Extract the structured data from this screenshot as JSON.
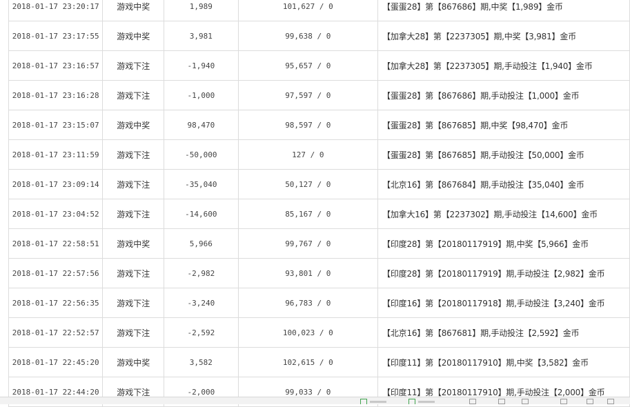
{
  "transactions": [
    {
      "time": "2018-01-17 23:20:17",
      "type": "游戏中奖",
      "amount": "1,989",
      "balance": "101,627 / 0",
      "desc": "【蛋蛋28】第【867686】期,中奖【1,989】金币"
    },
    {
      "time": "2018-01-17 23:17:55",
      "type": "游戏中奖",
      "amount": "3,981",
      "balance": "99,638 / 0",
      "desc": "【加拿大28】第【2237305】期,中奖【3,981】金币"
    },
    {
      "time": "2018-01-17 23:16:57",
      "type": "游戏下注",
      "amount": "-1,940",
      "balance": "95,657 / 0",
      "desc": "【加拿大28】第【2237305】期,手动投注【1,940】金币"
    },
    {
      "time": "2018-01-17 23:16:28",
      "type": "游戏下注",
      "amount": "-1,000",
      "balance": "97,597 / 0",
      "desc": "【蛋蛋28】第【867686】期,手动投注【1,000】金币"
    },
    {
      "time": "2018-01-17 23:15:07",
      "type": "游戏中奖",
      "amount": "98,470",
      "balance": "98,597 / 0",
      "desc": "【蛋蛋28】第【867685】期,中奖【98,470】金币"
    },
    {
      "time": "2018-01-17 23:11:59",
      "type": "游戏下注",
      "amount": "-50,000",
      "balance": "127 / 0",
      "desc": "【蛋蛋28】第【867685】期,手动投注【50,000】金币"
    },
    {
      "time": "2018-01-17 23:09:14",
      "type": "游戏下注",
      "amount": "-35,040",
      "balance": "50,127 / 0",
      "desc": "【北京16】第【867684】期,手动投注【35,040】金币"
    },
    {
      "time": "2018-01-17 23:04:52",
      "type": "游戏下注",
      "amount": "-14,600",
      "balance": "85,167 / 0",
      "desc": "【加拿大16】第【2237302】期,手动投注【14,600】金币"
    },
    {
      "time": "2018-01-17 22:58:51",
      "type": "游戏中奖",
      "amount": "5,966",
      "balance": "99,767 / 0",
      "desc": "【印度28】第【20180117919】期,中奖【5,966】金币"
    },
    {
      "time": "2018-01-17 22:57:56",
      "type": "游戏下注",
      "amount": "-2,982",
      "balance": "93,801 / 0",
      "desc": "【印度28】第【20180117919】期,手动投注【2,982】金币"
    },
    {
      "time": "2018-01-17 22:56:35",
      "type": "游戏下注",
      "amount": "-3,240",
      "balance": "96,783 / 0",
      "desc": "【印度16】第【20180117918】期,手动投注【3,240】金币"
    },
    {
      "time": "2018-01-17 22:52:57",
      "type": "游戏下注",
      "amount": "-2,592",
      "balance": "100,023 / 0",
      "desc": "【北京16】第【867681】期,手动投注【2,592】金币"
    },
    {
      "time": "2018-01-17 22:45:20",
      "type": "游戏中奖",
      "amount": "3,582",
      "balance": "102,615 / 0",
      "desc": "【印度11】第【20180117910】期,中奖【3,582】金币"
    },
    {
      "time": "2018-01-17 22:44:20",
      "type": "游戏下注",
      "amount": "-2,000",
      "balance": "99,033 / 0",
      "desc": "【印度11】第【20180117910】期,手动投注【2,000】金币"
    }
  ]
}
